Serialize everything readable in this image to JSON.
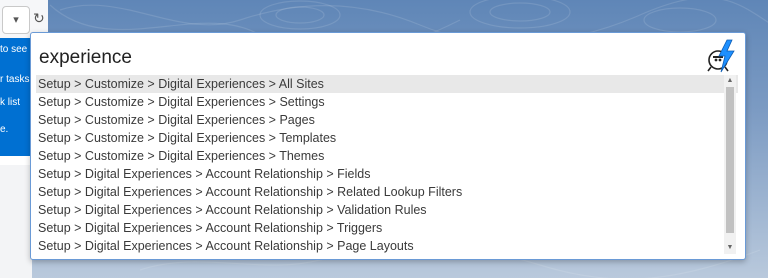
{
  "background": {
    "help_lines": [
      "to see",
      "r tasks.",
      "k list",
      "e."
    ]
  },
  "search": {
    "query": "experience"
  },
  "logo": {
    "icon": "lightning-bolt-ninja-icon",
    "accent": "#1e90ff"
  },
  "results": [
    "Setup > Customize > Digital Experiences > All Sites",
    "Setup > Customize > Digital Experiences > Settings",
    "Setup > Customize > Digital Experiences > Pages",
    "Setup > Customize > Digital Experiences > Templates",
    "Setup > Customize > Digital Experiences > Themes",
    "Setup > Digital Experiences > Account Relationship > Fields",
    "Setup > Digital Experiences > Account Relationship > Related Lookup Filters",
    "Setup > Digital Experiences > Account Relationship > Validation Rules",
    "Setup > Digital Experiences > Account Relationship > Triggers",
    "Setup > Digital Experiences > Account Relationship > Page Layouts"
  ],
  "selected_index": 0
}
